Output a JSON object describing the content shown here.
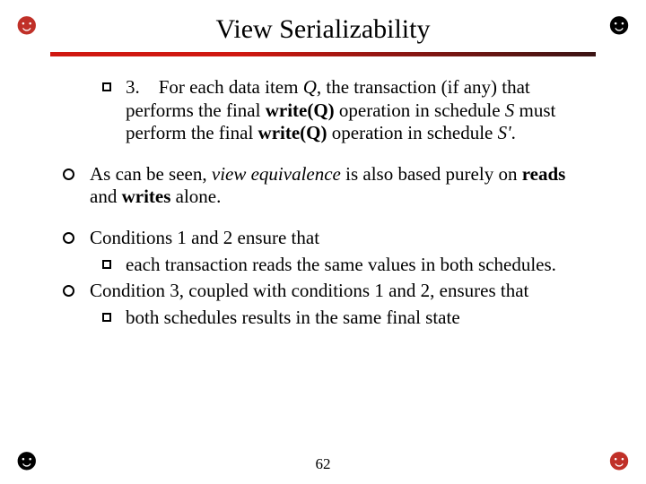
{
  "icons": {
    "tl_glyph": "☻",
    "tr_glyph": "☻",
    "bl_glyph": "☻",
    "br_glyph": "☻"
  },
  "title": "View Serializability",
  "b1": {
    "num": "3.",
    "pre": "For each data item ",
    "Q": "Q",
    "mid1": ", the transaction (if any) that performs the final ",
    "w1": "write(Q)",
    "mid2": " operation in schedule ",
    "S": "S",
    "mid3": " must perform the final ",
    "w2": "write(Q)",
    "mid4": " operation in schedule ",
    "Sp": "S'",
    "end": "."
  },
  "b2": {
    "pre": "As can be seen, ",
    "ve": "view equivalence",
    "mid1": " is also based purely on ",
    "reads": "reads",
    "and": " and ",
    "writes": "writes",
    "end": " alone."
  },
  "b3": "Conditions 1 and 2 ensure that",
  "b3a": "each transaction reads the same values in both schedules.",
  "b4": "Condition 3, coupled with conditions 1 and 2, ensures that",
  "b4a": "both schedules results in the same final state",
  "pagenum": "62"
}
